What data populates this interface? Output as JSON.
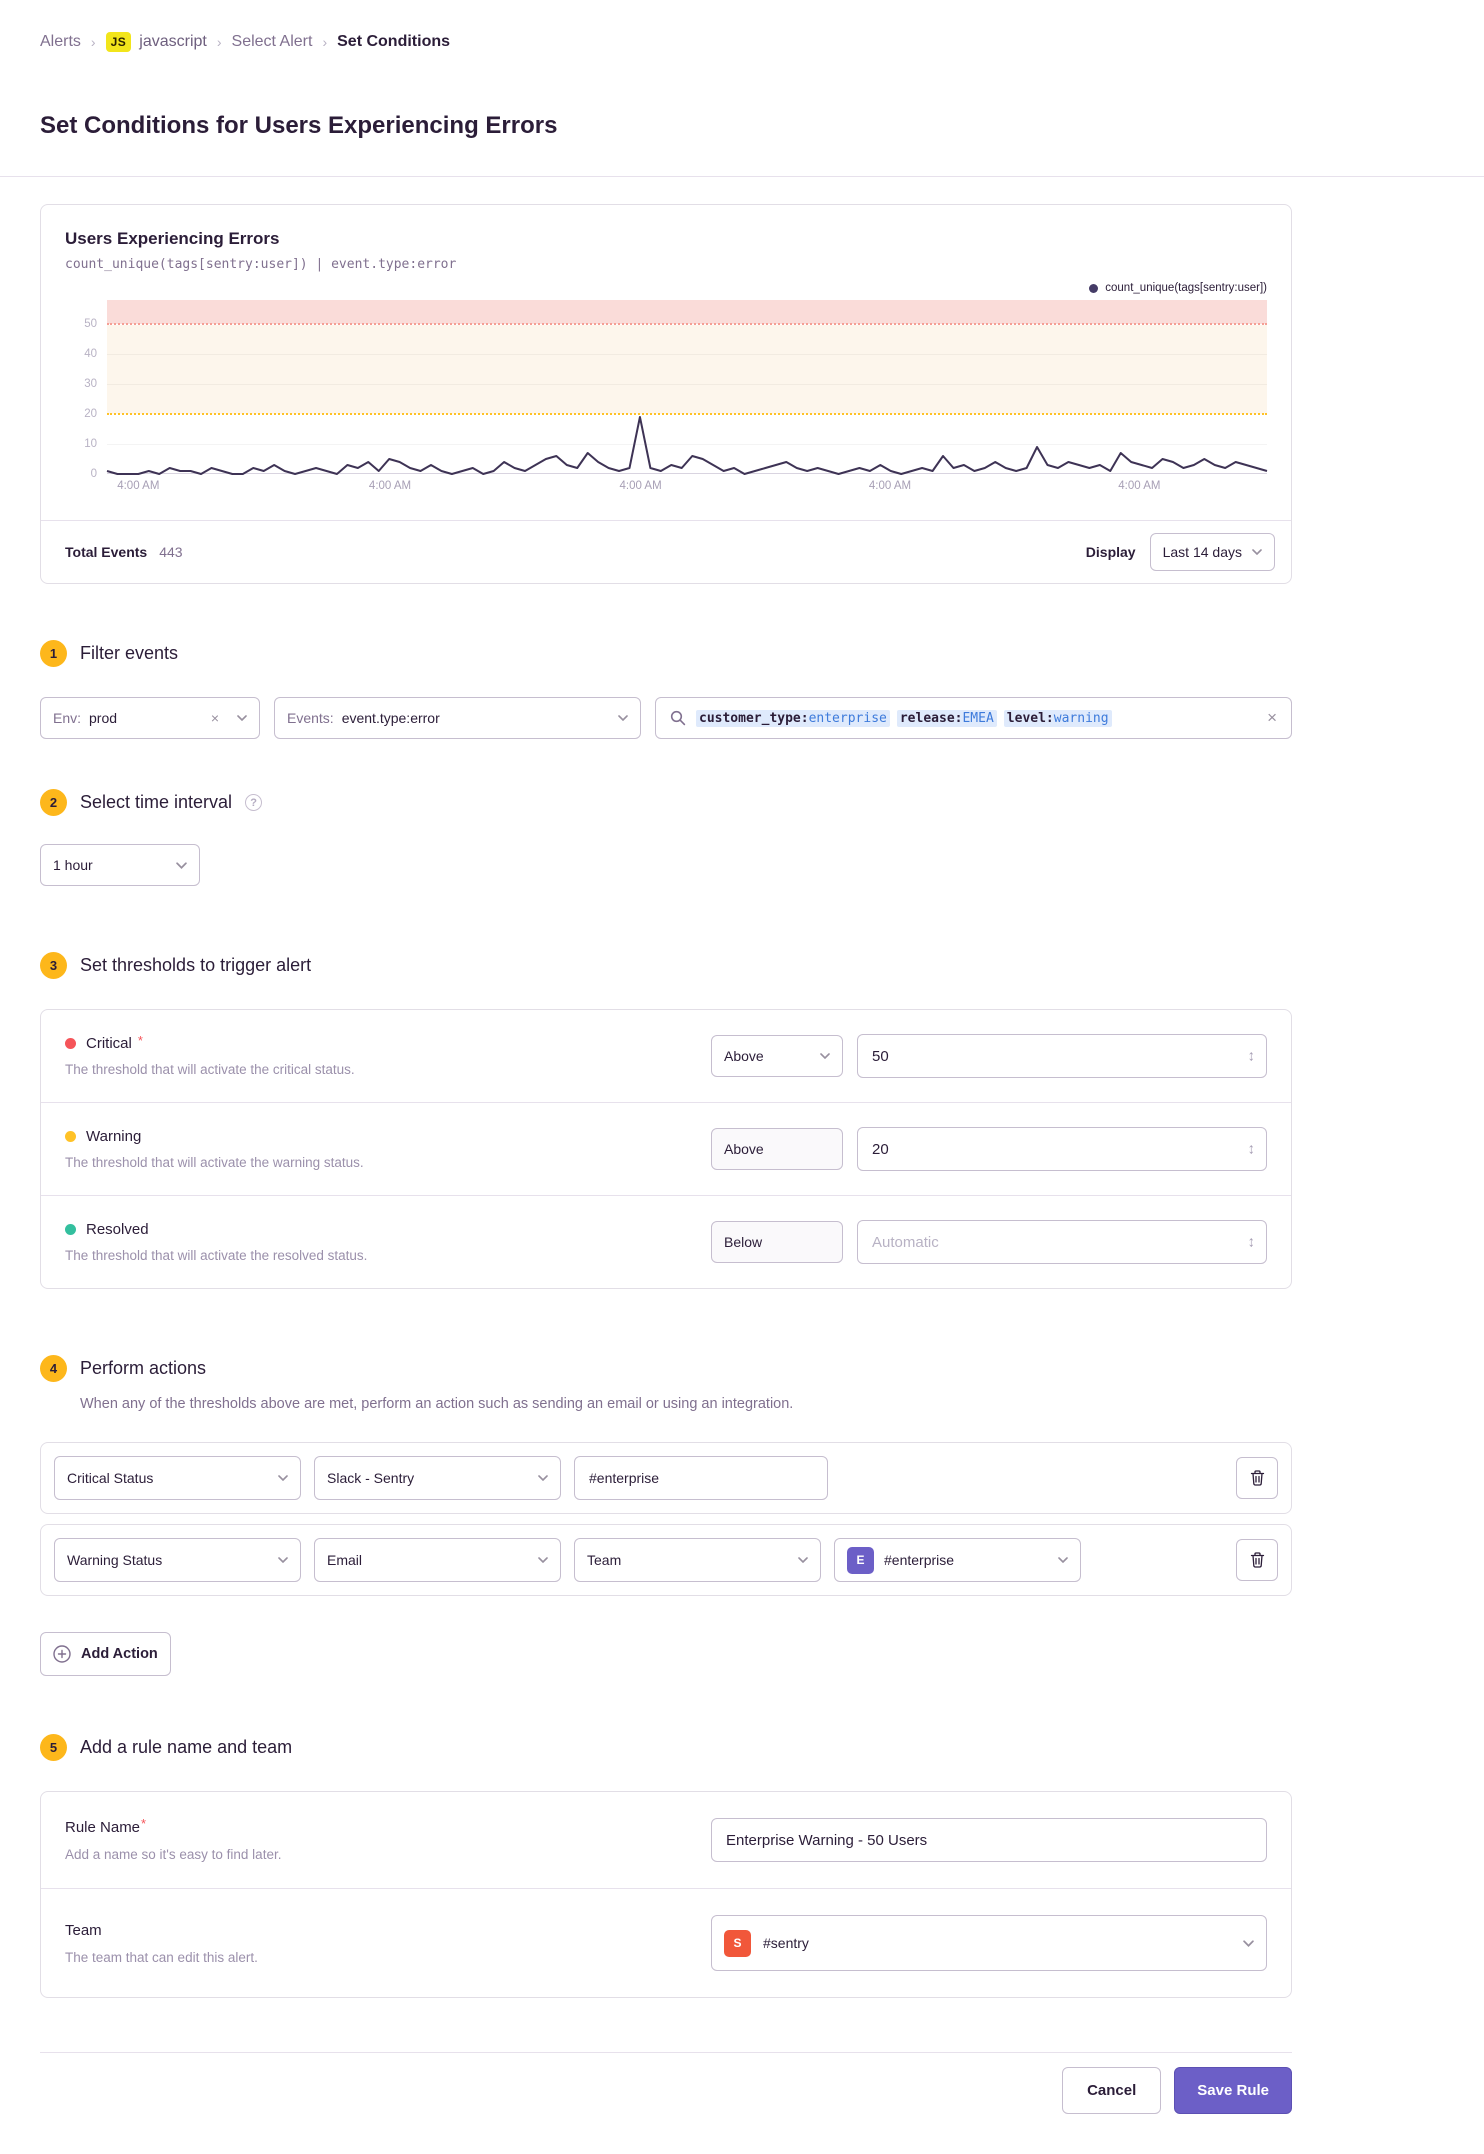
{
  "breadcrumb": {
    "alerts": "Alerts",
    "project_badge": "JS",
    "project": "javascript",
    "select_alert": "Select Alert",
    "current": "Set Conditions",
    "separator": "›"
  },
  "page": {
    "title": "Set Conditions for Users Experiencing Errors"
  },
  "chart_panel": {
    "title": "Users Experiencing Errors",
    "query": "count_unique(tags[sentry:user]) | event.type:error",
    "legend": "count_unique(tags[sentry:user])",
    "total_events_label": "Total Events",
    "total_events_value": "443",
    "display_label": "Display",
    "display_value": "Last 14 days"
  },
  "chart_data": {
    "type": "line",
    "title": "Users Experiencing Errors",
    "ylabel": "count_unique(tags[sentry:user])",
    "ylim": [
      0,
      58
    ],
    "y_ticks": [
      "50",
      "40",
      "30",
      "20",
      "10",
      "0"
    ],
    "x_labels": [
      "4:00 AM",
      "4:00 AM",
      "4:00 AM",
      "4:00 AM",
      "4:00 AM"
    ],
    "thresholds": {
      "critical": 50,
      "warning": 20
    },
    "legend_position": "top-right",
    "grid": true,
    "series": [
      {
        "name": "count_unique(tags[sentry:user])",
        "values": [
          1,
          0,
          0,
          0,
          1,
          0,
          2,
          1,
          1,
          0,
          2,
          1,
          0,
          0,
          2,
          1,
          3,
          1,
          0,
          1,
          2,
          1,
          0,
          3,
          2,
          4,
          1,
          5,
          4,
          2,
          1,
          3,
          1,
          0,
          1,
          2,
          0,
          1,
          4,
          2,
          1,
          3,
          5,
          6,
          3,
          2,
          7,
          4,
          2,
          1,
          2,
          19,
          2,
          1,
          3,
          2,
          6,
          5,
          3,
          1,
          2,
          0,
          1,
          2,
          3,
          4,
          2,
          1,
          2,
          1,
          0,
          1,
          2,
          1,
          3,
          1,
          0,
          1,
          2,
          1,
          6,
          2,
          3,
          1,
          2,
          4,
          2,
          1,
          2,
          9,
          3,
          2,
          4,
          3,
          2,
          3,
          1,
          7,
          4,
          3,
          2,
          5,
          4,
          2,
          3,
          5,
          3,
          2,
          4,
          3,
          2,
          1
        ]
      }
    ],
    "colors": {
      "line": "#3e3355",
      "critical_band": "#fadcd9",
      "critical_line": "#f59e94",
      "warning_band": "#fdf6ec",
      "warning_line": "#ffc227"
    }
  },
  "steps": {
    "s1": {
      "num": "1",
      "title": "Filter events"
    },
    "s2": {
      "num": "2",
      "title": "Select time interval"
    },
    "s3": {
      "num": "3",
      "title": "Set thresholds to trigger alert"
    },
    "s4": {
      "num": "4",
      "title": "Perform actions"
    },
    "s5": {
      "num": "5",
      "title": "Add a rule name and team"
    }
  },
  "filters": {
    "env": {
      "label": "Env:",
      "value": "prod"
    },
    "events": {
      "label": "Events:",
      "value": "event.type:error"
    },
    "search_tokens": [
      {
        "key": "customer_type:",
        "value": "enterprise"
      },
      {
        "key": "release:",
        "value": "EMEA"
      },
      {
        "key": "level:",
        "value": "warning"
      }
    ]
  },
  "interval": {
    "value": "1 hour"
  },
  "thresholds": {
    "rows": [
      {
        "label": "Critical",
        "required": "*",
        "description": "The threshold that will activate the critical status.",
        "condition": "Above",
        "value": "50",
        "placeholder": "",
        "dot_color": "#f55459"
      },
      {
        "label": "Warning",
        "required": "",
        "description": "The threshold that will activate the warning status.",
        "condition": "Above",
        "value": "20",
        "placeholder": "",
        "dot_color": "#ffc227"
      },
      {
        "label": "Resolved",
        "required": "",
        "description": "The threshold that will activate the resolved status.",
        "condition": "Below",
        "value": "",
        "placeholder": "Automatic",
        "dot_color": "#33bf9e"
      }
    ]
  },
  "actions": {
    "description": "When any of the thresholds above are met, perform an action such as sending an email or using an integration.",
    "rows": [
      {
        "trigger": "Critical Status",
        "service": "Slack - Sentry",
        "target_value": "#enterprise"
      },
      {
        "trigger": "Warning Status",
        "service": "Email",
        "target_type": "Team",
        "team_avatar": "E",
        "team_value": "#enterprise"
      }
    ],
    "add_button": "Add Action"
  },
  "rule": {
    "name_label": "Rule Name",
    "name_required": "*",
    "name_help": "Add a name so it's easy to find later.",
    "name_value": "Enterprise Warning - 50 Users",
    "team_label": "Team",
    "team_help": "The team that can edit this alert.",
    "team_avatar": "S",
    "team_value": "#sentry"
  },
  "footer": {
    "cancel": "Cancel",
    "save": "Save Rule"
  },
  "colors": {
    "accent": "#6c5fc7",
    "critical": "#f55459",
    "warning": "#ffc227",
    "resolved": "#33bf9e",
    "step_badge": "#fdb71b"
  }
}
